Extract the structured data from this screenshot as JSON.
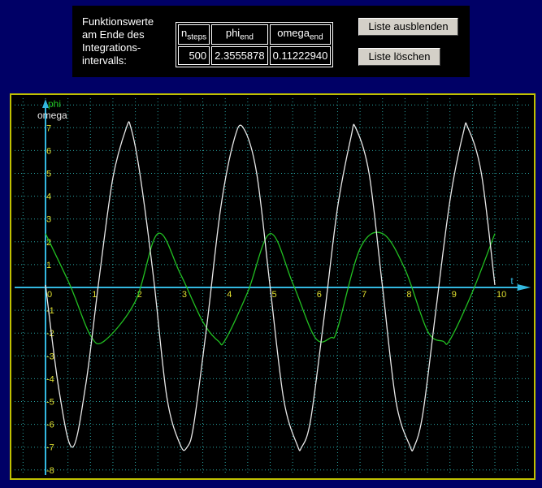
{
  "panel": {
    "label": "Funktionswerte\nam Ende des\nIntegrations-\nintervalls:",
    "table": {
      "headers": [
        {
          "base": "n",
          "sub": "steps"
        },
        {
          "base": "phi",
          "sub": "end"
        },
        {
          "base": "omega",
          "sub": "end"
        }
      ],
      "values": [
        "500",
        "2.3555878",
        "0.11222940"
      ]
    },
    "buttons": {
      "hide": "Liste ausblenden",
      "clear": "Liste löschen"
    }
  },
  "colors": {
    "background": "#000066",
    "plot_background": "#000000",
    "grid": "#2aa5a5",
    "axis": "#33b8e0",
    "tick_labels": "#e0e030",
    "phi_curve": "#22c022",
    "omega_curve": "#e8e8e8",
    "frame": "#c0c000"
  },
  "chart_data": {
    "type": "line",
    "xlabel": "t",
    "ylabels": [
      "phi",
      "omega"
    ],
    "xlim": [
      0,
      10
    ],
    "ylim": [
      -8,
      7
    ],
    "xticks": [
      "0",
      "1",
      "2",
      "3",
      "4",
      "5",
      "6",
      "7",
      "8",
      "9",
      "10"
    ],
    "yticks": [
      "7",
      "6",
      "5",
      "4",
      "3",
      "2",
      "1",
      "0",
      "-1",
      "-2",
      "-3",
      "-4",
      "-5",
      "-6",
      "-7",
      "-8"
    ],
    "grid": true,
    "series": [
      {
        "name": "phi",
        "x": [
          0,
          0.5,
          0.65,
          1.0,
          1.3,
          2.0,
          2.5,
          3.0,
          3.5,
          3.85,
          4.0,
          4.5,
          5.0,
          5.5,
          6.0,
          6.35,
          6.5,
          7.0,
          7.5,
          8.0,
          8.5,
          8.85,
          9.0,
          9.5,
          10.0
        ],
        "y": [
          2.36,
          0.3,
          -0.4,
          -2.1,
          -2.36,
          -0.6,
          2.36,
          0.6,
          -1.5,
          -2.36,
          -2.3,
          -0.2,
          2.36,
          0.2,
          -2.2,
          -2.2,
          -1.8,
          1.7,
          2.36,
          0.8,
          -1.9,
          -2.36,
          -2.3,
          -0.2,
          2.36
        ]
      },
      {
        "name": "omega",
        "x": [
          0,
          0.3,
          0.6,
          0.9,
          1.2,
          1.5,
          1.8,
          1.9,
          2.1,
          2.4,
          2.7,
          3.0,
          3.15,
          3.3,
          3.6,
          3.9,
          4.2,
          4.4,
          4.7,
          5.0,
          5.3,
          5.6,
          5.7,
          5.9,
          6.2,
          6.5,
          6.8,
          6.9,
          7.2,
          7.5,
          7.8,
          8.1,
          8.2,
          8.4,
          8.7,
          9.0,
          9.3,
          9.4,
          9.7,
          10.0
        ],
        "y": [
          0.11,
          -4.5,
          -7.0,
          -4.2,
          0.5,
          4.8,
          7.0,
          7.0,
          5.0,
          0.5,
          -4.8,
          -6.9,
          -7.0,
          -6.0,
          -1.5,
          3.5,
          6.5,
          7.0,
          5.0,
          0.0,
          -4.9,
          -6.9,
          -7.0,
          -5.8,
          -1.3,
          3.5,
          6.6,
          7.0,
          5.0,
          0.0,
          -5.0,
          -6.9,
          -7.0,
          -5.5,
          -0.8,
          3.8,
          6.8,
          7.0,
          5.0,
          0.11
        ]
      }
    ]
  }
}
